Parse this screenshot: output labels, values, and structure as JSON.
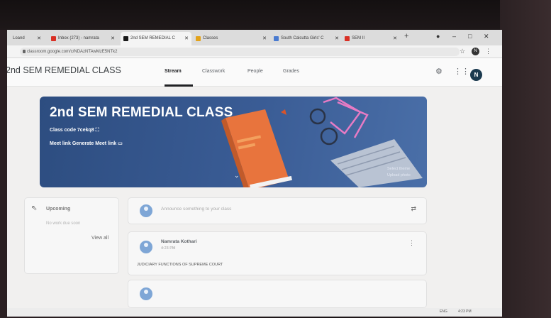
{
  "browser": {
    "tabs": [
      {
        "label": "Loand",
        "color": "#999999"
      },
      {
        "label": "Inbox (273) - namrata",
        "color": "#d93025"
      },
      {
        "label": "2nd SEM REMEDIAL C",
        "color": "#1a1a1a",
        "active": true
      },
      {
        "label": "Classes",
        "color": "#e3a21a"
      },
      {
        "label": "South Calcutta Girls' C",
        "color": "#4a7bd0"
      },
      {
        "label": "SEM II",
        "color": "#d93025"
      }
    ],
    "url": "classroom.google.com/c/NDAzNTAwMzE5NTk2",
    "profile_initial": "N"
  },
  "app": {
    "class_title": "2nd SEM REMEDIAL CLASS",
    "tabs": [
      "Stream",
      "Classwork",
      "People",
      "Grades"
    ],
    "avatar_initial": "N"
  },
  "banner": {
    "title": "2nd SEM REMEDIAL CLASS",
    "class_code": "Class code  7cekq8",
    "meet_link": "Meet link  Generate Meet link",
    "select_theme": "Select theme",
    "upload_photo": "Upload photo"
  },
  "upcoming": {
    "title": "Upcoming",
    "subtitle": "No work due soon",
    "view_all": "View all"
  },
  "stream": {
    "announce_placeholder": "Announce something to your class",
    "post": {
      "author": "Namrata Kothari",
      "time": "4:23 PM",
      "body": "JUDICIARY FUNCTIONS OF SUPREME COURT"
    }
  },
  "system": {
    "lang": "ENG",
    "time": "4:23 PM"
  }
}
